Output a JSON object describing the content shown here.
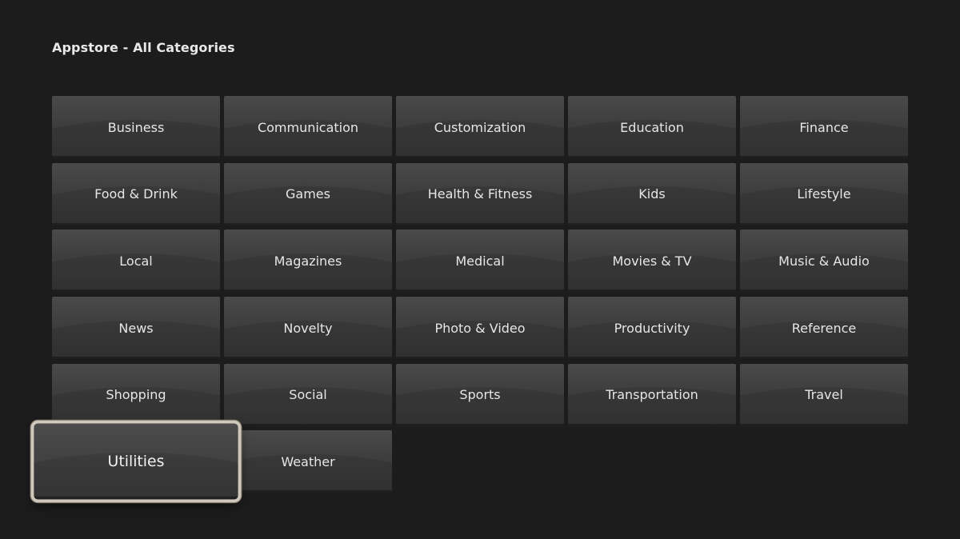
{
  "header": {
    "title": "Appstore - All Categories"
  },
  "categories": [
    {
      "label": "Business"
    },
    {
      "label": "Communication"
    },
    {
      "label": "Customization"
    },
    {
      "label": "Education"
    },
    {
      "label": "Finance"
    },
    {
      "label": "Food & Drink"
    },
    {
      "label": "Games"
    },
    {
      "label": "Health & Fitness"
    },
    {
      "label": "Kids"
    },
    {
      "label": "Lifestyle"
    },
    {
      "label": "Local"
    },
    {
      "label": "Magazines"
    },
    {
      "label": "Medical"
    },
    {
      "label": "Movies & TV"
    },
    {
      "label": "Music & Audio"
    },
    {
      "label": "News"
    },
    {
      "label": "Novelty"
    },
    {
      "label": "Photo & Video"
    },
    {
      "label": "Productivity"
    },
    {
      "label": "Reference"
    },
    {
      "label": "Shopping"
    },
    {
      "label": "Social"
    },
    {
      "label": "Sports"
    },
    {
      "label": "Transportation"
    },
    {
      "label": "Travel"
    },
    {
      "label": "Utilities",
      "focused": true
    },
    {
      "label": "Weather"
    }
  ],
  "colors": {
    "background": "#1c1c1c",
    "tile": "#3e3e3e",
    "focus_border": "#cfc8bd",
    "text": "#e6e6e6"
  }
}
